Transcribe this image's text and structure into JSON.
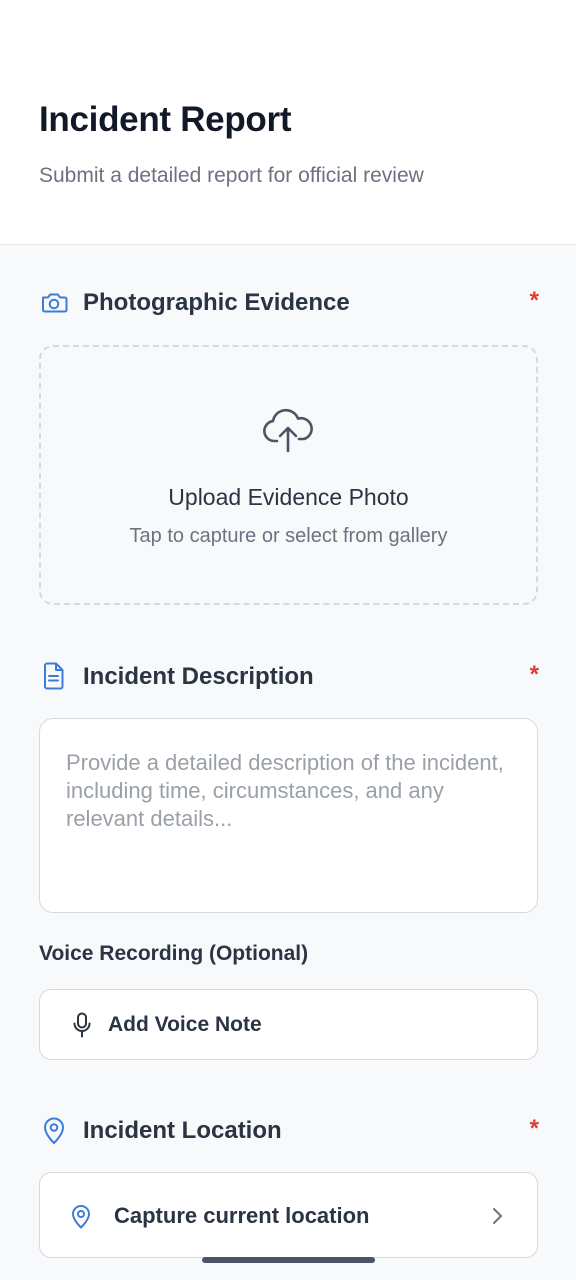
{
  "header": {
    "title": "Incident Report",
    "subtitle": "Submit a detailed report for official review"
  },
  "photo_section": {
    "icon": "camera-icon",
    "label": "Photographic Evidence",
    "required_mark": "*",
    "upload_title": "Upload Evidence Photo",
    "upload_subtitle": "Tap to capture or select from gallery",
    "upload_icon": "cloud-upload-icon"
  },
  "description_section": {
    "icon": "document-icon",
    "label": "Incident Description",
    "required_mark": "*",
    "placeholder": "Provide a detailed description of the incident, including time, circumstances, and any relevant details...",
    "value": ""
  },
  "voice_section": {
    "label": "Voice Recording (Optional)",
    "button_label": "Add Voice Note",
    "icon": "microphone-icon"
  },
  "location_section": {
    "icon": "map-pin-icon",
    "label": "Incident Location",
    "required_mark": "*",
    "button_label": "Capture current location",
    "chevron_icon": "chevron-right-icon"
  },
  "colors": {
    "accent": "#3b7dd8",
    "required": "#e53935",
    "text_dark": "#2b3442",
    "text_muted": "#6b7280"
  }
}
